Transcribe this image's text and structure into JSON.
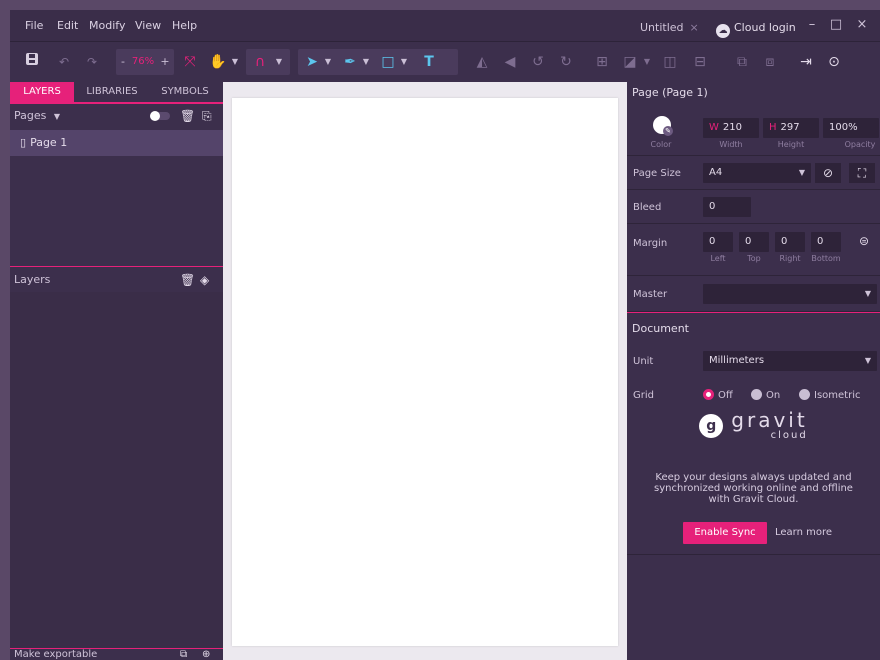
{
  "menubar": {
    "items": [
      "File",
      "Edit",
      "Modify",
      "View",
      "Help"
    ],
    "doc_tab": "Untitled",
    "doc_tab_close": "×",
    "cloud_login": "Cloud login",
    "minimize": "–",
    "maximize": "□",
    "close": "×"
  },
  "toolbar": {
    "zoom_minus": "-",
    "zoom_value": "76%",
    "zoom_plus": "+"
  },
  "left_panel": {
    "tabs": [
      "LAYERS",
      "LIBRARIES",
      "SYMBOLS"
    ],
    "active_tab": "LAYERS",
    "pages_label": "Pages",
    "pages": [
      "Page 1"
    ],
    "layers_label": "Layers",
    "footer_label": "Make exportable"
  },
  "right_panel": {
    "page_header": "Page (Page 1)",
    "color_label": "Color",
    "width_prefix": "W",
    "width_value": "210",
    "width_label": "Width",
    "height_prefix": "H",
    "height_value": "297",
    "height_label": "Height",
    "opacity_value": "100%",
    "opacity_label": "Opacity",
    "page_size_label": "Page Size",
    "page_size_value": "A4",
    "bleed_label": "Bleed",
    "bleed_value": "0",
    "margin_label": "Margin",
    "margins": [
      {
        "value": "0",
        "label": "Left"
      },
      {
        "value": "0",
        "label": "Top"
      },
      {
        "value": "0",
        "label": "Right"
      },
      {
        "value": "0",
        "label": "Bottom"
      }
    ],
    "master_label": "Master",
    "master_value": "",
    "document_header": "Document",
    "unit_label": "Unit",
    "unit_value": "Millimeters",
    "grid_label": "Grid",
    "grid_options": [
      "Off",
      "On",
      "Isometric"
    ],
    "grid_selected": "Off",
    "logo_text": "gravit",
    "logo_sub": "cloud",
    "sync_text_1": "Keep your designs always updated and",
    "sync_text_2": "synchronized working online and offline",
    "sync_text_3": "with Gravit Cloud.",
    "enable_sync": "Enable Sync",
    "learn_more": "Learn more"
  },
  "colors": {
    "accent": "#e6217a",
    "panel_bg": "#3c2f4c",
    "canvas_bg": "#ece9ef"
  }
}
